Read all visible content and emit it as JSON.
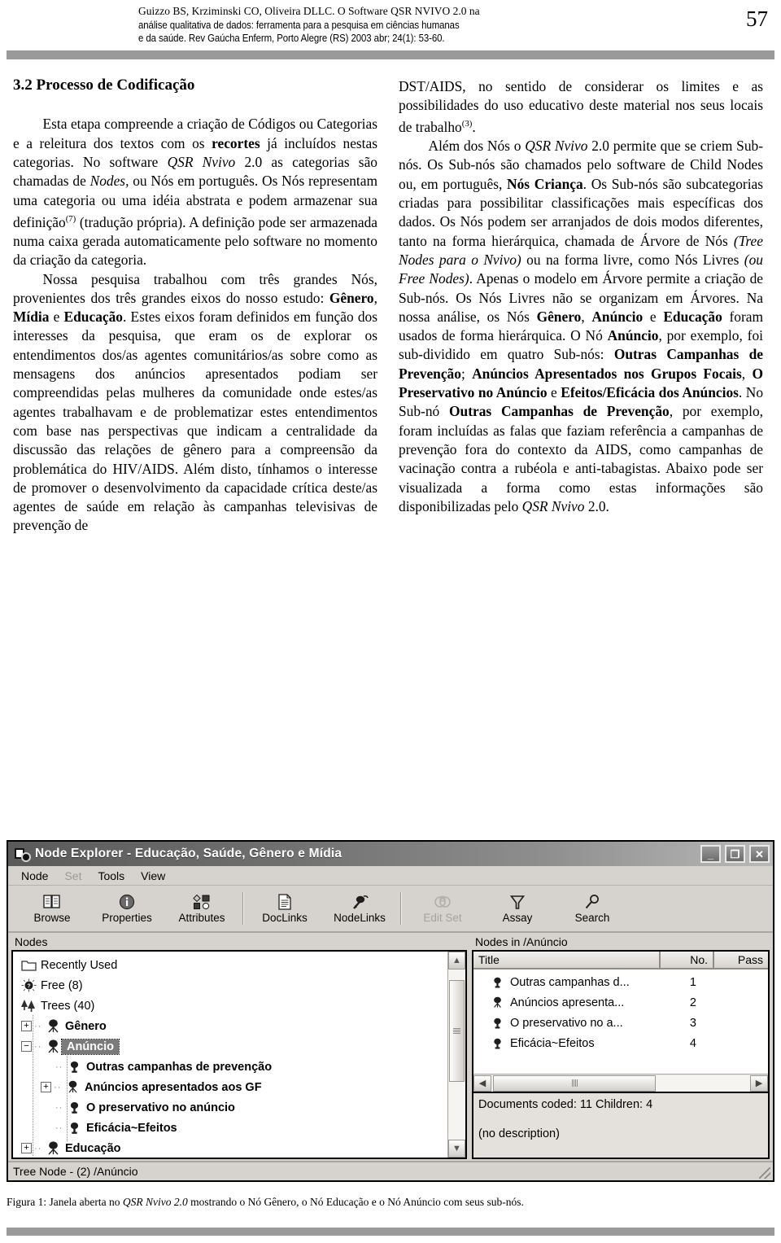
{
  "running_head": {
    "line1": "Guizzo BS, Krziminski CO, Oliveira DLLC. O Software QSR NVIVO 2.0 na",
    "line2": "análise qualitativa de dados: ferramenta para a pesquisa em ciências humanas",
    "line3": "e da saúde. Rev Gaúcha Enferm, Porto Alegre (RS) 2003 abr; 24(1): 53-60.",
    "folio": "57"
  },
  "left_column": {
    "section_title": "3.2 Processo de Codificação",
    "paragraph1_html": "Esta etapa compreende a criação de Códigos ou Categorias e a releitura dos textos com os <b>recortes</b> já incluídos nestas categorias. No software <i>QSR Nvivo</i> 2.0 as categorias são chamadas de <i>Nodes,</i> ou Nós em português. Os Nós representam uma categoria ou uma idéia abstrata e podem armazenar sua definição<sup>(7)</sup> (tradução própria). A definição pode ser armazenada numa caixa gerada automaticamente pelo software no momento da criação da categoria.",
    "paragraph2_html": "Nossa pesquisa trabalhou com três grandes Nós, provenientes dos três grandes eixos do nosso estudo: <b>Gênero</b>, <b>Mídia</b> e <b>Educação</b>. Estes eixos foram definidos em função dos interesses da pesquisa, que eram os de explorar os entendimentos dos/as agentes comunitários/as sobre como as mensagens dos anúncios apresentados podiam ser compreendidas pelas mulheres da comunidade onde estes/as agentes trabalhavam e de problematizar estes entendimentos com base nas perspectivas que indicam a centralidade da discussão das relações de gênero para a compreensão da problemática do HIV/AIDS. Além disto, tínhamos o interesse de promover o desenvolvimento da capacidade crítica deste/as agentes de saúde em relação às campanhas televisivas de prevenção de"
  },
  "right_column": {
    "paragraph1_html": "DST/AIDS, no sentido de considerar os limites e as possibilidades do uso educativo deste material nos seus locais de trabalho<sup>(3)</sup>.",
    "paragraph2_html": "Além dos Nós o <i>QSR Nvivo</i> 2.0 permite que se criem Sub-nós. Os Sub-nós são chamados pelo software de Child Nodes ou, em português, <b>Nós Criança</b>. Os Sub-nós são subcategorias criadas para possibilitar classificações mais específicas dos dados. Os Nós podem ser arranjados de dois modos diferentes, tanto na forma hierárquica, chamada de Árvore de Nós <i>(Tree Nodes para o Nvivo)</i> ou na forma livre, como Nós Livres <i>(ou Free Nodes)</i>. Apenas o modelo em Árvore permite a criação de Sub-nós. Os Nós Livres não se organizam em Árvores. Na nossa análise, os Nós <b>Gênero</b>, <b>Anúncio</b> e <b>Educação</b> foram usados de forma hierárquica. O Nó <b>Anúncio</b>, por exemplo, foi sub-dividido em quatro Sub-nós: <b>Outras Campanhas de Prevenção</b>; <b>Anúncios Apresentados nos Grupos Focais</b>, <b>O Preservativo no Anúncio</b> e <b>Efeitos/Eficácia dos Anúncios</b>. No Sub-nó <b>Outras Campanhas de Prevenção</b>, por exemplo, foram incluídas as falas que faziam referência a campanhas de prevenção fora do contexto da AIDS, como campanhas de vacinação contra a rubéola e anti-tabagistas. Abaixo pode ser visualizada a forma como estas informações são disponibilizadas pelo <i>QSR Nvivo</i> 2.0."
  },
  "app_window": {
    "title": "Node Explorer - Educação, Saúde, Gênero e Mídia",
    "title_icon": "node-explorer-icon",
    "window_buttons": [
      {
        "name": "minimize-button",
        "glyph": "_"
      },
      {
        "name": "maximize-button",
        "glyph": "❐"
      },
      {
        "name": "close-button",
        "glyph": "✕"
      }
    ],
    "menu": [
      {
        "label": "Node",
        "disabled": false
      },
      {
        "label": "Set",
        "disabled": true
      },
      {
        "label": "Tools",
        "disabled": false
      },
      {
        "label": "View",
        "disabled": false
      }
    ],
    "toolbar": [
      {
        "label": "Browse",
        "icon": "book-icon",
        "disabled": false
      },
      {
        "label": "Properties",
        "icon": "info-icon",
        "disabled": false
      },
      {
        "label": "Attributes",
        "icon": "shapes-icon",
        "disabled": false
      },
      {
        "sep": true
      },
      {
        "label": "DocLinks",
        "icon": "document-icon",
        "disabled": false
      },
      {
        "label": "NodeLinks",
        "icon": "node-link-icon",
        "disabled": false
      },
      {
        "sep": true
      },
      {
        "label": "Edit Set",
        "icon": "edit-set-icon",
        "disabled": true
      },
      {
        "label": "Assay",
        "icon": "funnel-icon",
        "disabled": false
      },
      {
        "label": "Search",
        "icon": "magnifier-icon",
        "disabled": false
      }
    ],
    "left_pane": {
      "label": "Nodes",
      "tree": [
        {
          "label": "Recently Used",
          "icon": "folder-icon",
          "indent": 0,
          "expander": "",
          "bold": false,
          "selected": false
        },
        {
          "label": "Free (8)",
          "icon": "free-node-icon",
          "indent": 0,
          "expander": "",
          "bold": false,
          "selected": false
        },
        {
          "label": "Trees (40)",
          "icon": "trees-icon",
          "indent": 0,
          "expander": "",
          "bold": false,
          "selected": false
        },
        {
          "label": "Gênero",
          "icon": "tree-node-icon",
          "indent": 1,
          "expander": "+",
          "bold": true,
          "selected": false
        },
        {
          "label": "Anúncio",
          "icon": "tree-node-icon",
          "indent": 1,
          "expander": "−",
          "bold": true,
          "selected": true
        },
        {
          "label": "Outras campanhas de prevenção",
          "icon": "child-node-icon",
          "indent": 2,
          "expander": "",
          "bold": true,
          "selected": false
        },
        {
          "label": "Anúncios apresentados aos GF",
          "icon": "tree-node-icon",
          "indent": 2,
          "expander": "+",
          "bold": true,
          "selected": false
        },
        {
          "label": "O preservativo no anúncio",
          "icon": "child-node-icon",
          "indent": 2,
          "expander": "",
          "bold": true,
          "selected": false
        },
        {
          "label": "Eficácia~Efeitos",
          "icon": "child-node-icon",
          "indent": 2,
          "expander": "",
          "bold": true,
          "selected": false
        },
        {
          "label": "Educação",
          "icon": "tree-node-icon",
          "indent": 1,
          "expander": "+",
          "bold": true,
          "selected": false
        }
      ]
    },
    "right_pane": {
      "label": "Nodes in /Anúncio",
      "columns": [
        "Title",
        "No.",
        "Pass"
      ],
      "rows": [
        {
          "title": "Outras campanhas d...",
          "no": "1",
          "pass": "",
          "icon": "child-node-icon"
        },
        {
          "title": "Anúncios apresenta...",
          "no": "2",
          "pass": "",
          "icon": "tree-node-icon"
        },
        {
          "title": "O preservativo no a...",
          "no": "3",
          "pass": "",
          "icon": "child-node-icon"
        },
        {
          "title": "Eficácia~Efeitos",
          "no": "4",
          "pass": "",
          "icon": "child-node-icon"
        }
      ],
      "info_line1": "Documents coded: 11 Children: 4",
      "info_line2": "(no description)"
    },
    "status_bar": "Tree Node - (2) /Anúncio"
  },
  "figure_caption_html": "Figura 1: Janela aberta no <i>QSR Nvivo 2.0</i> mostrando o Nó Gênero, o Nó Educação e o Nó Anúncio com seus sub-nós.",
  "colors": {
    "rule_gray": "#9a9a9a",
    "window_face": "#d6d3ce",
    "selection_gray": "#7b7b7b"
  }
}
